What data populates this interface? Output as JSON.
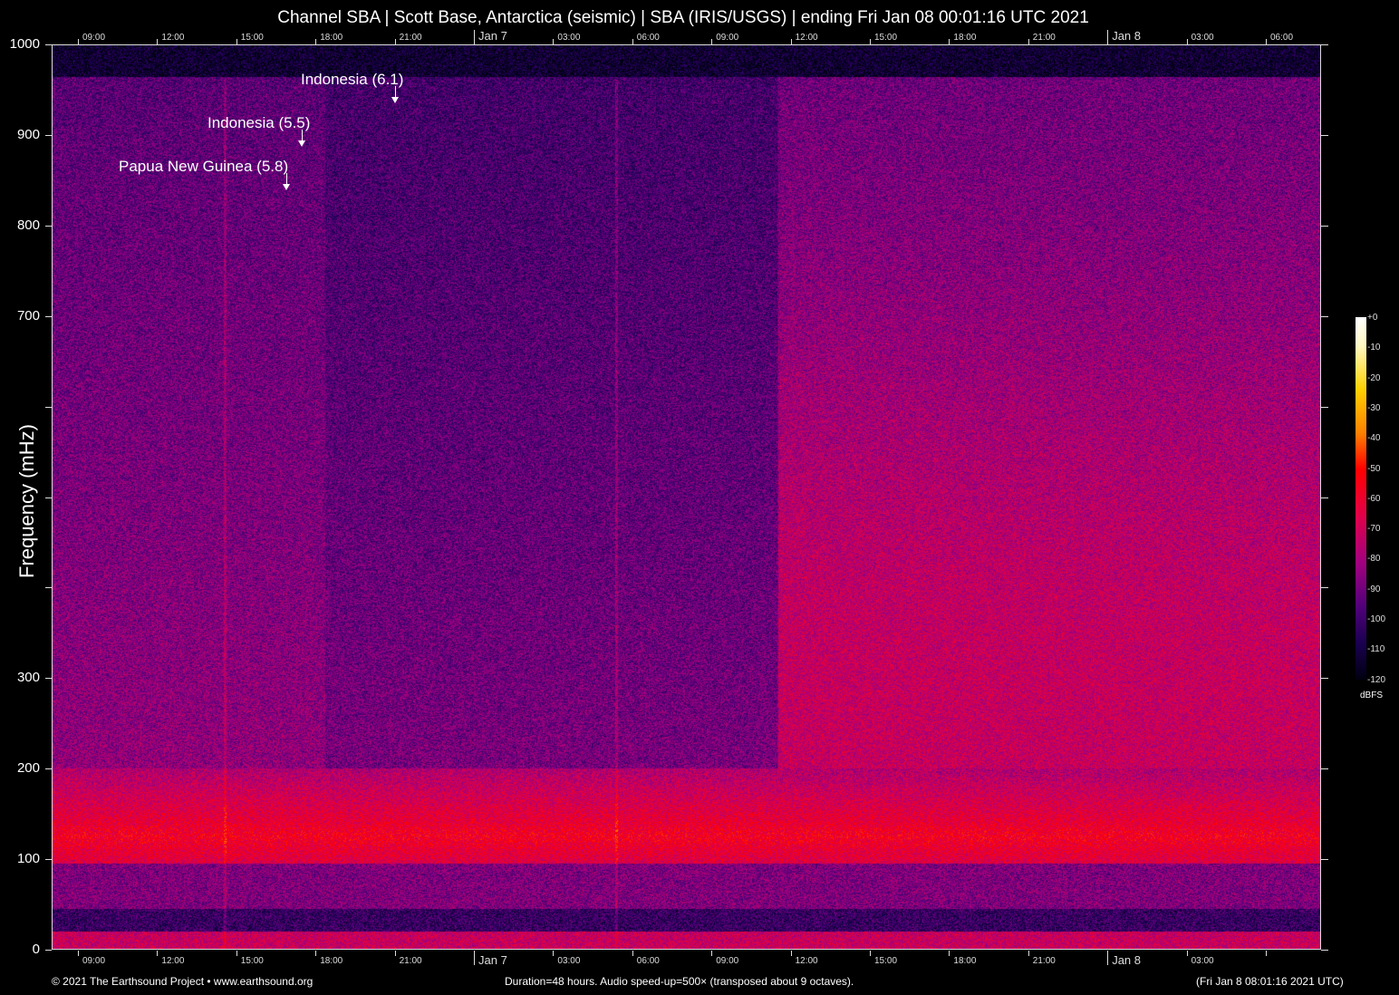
{
  "chart_data": {
    "type": "heatmap",
    "title": "Channel SBA | Scott Base, Antarctica (seismic) | SBA (IRIS/USGS) | ending Fri Jan 08 00:01:16 UTC 2021",
    "ylabel": "Frequency (mHz)",
    "ylim": [
      0,
      1000
    ],
    "y_ticks": [
      "0",
      "100",
      "200",
      "300",
      "",
      "",
      "",
      "700",
      "800",
      "900",
      "1000"
    ],
    "x_ticks_bottom": [
      "09:00",
      "12:00",
      "15:00",
      "18:00",
      "21:00",
      "Jan  7",
      "03:00",
      "06:00",
      "09:00",
      "12:00",
      "15:00",
      "18:00",
      "21:00",
      "Jan  8",
      "03:00",
      ""
    ],
    "x_ticks_top": [
      "09:00",
      "12:00",
      "15:00",
      "18:00",
      "21:00",
      "Jan  7",
      "03:00",
      "06:00",
      "09:00",
      "12:00",
      "15:00",
      "18:00",
      "21:00",
      "Jan  8",
      "03:00",
      "06:00"
    ],
    "colorbar": {
      "label": "dBFS",
      "ticks": [
        "+0",
        "-10",
        "-20",
        "-30",
        "-40",
        "-50",
        "-60",
        "-70",
        "-80",
        "-90",
        "-100",
        "-110",
        "-120"
      ],
      "range": [
        -120,
        0
      ]
    },
    "annotations": [
      {
        "text": "Indonesia (6.1)",
        "hours_from_start": 15.5
      },
      {
        "text": "Indonesia (5.5)",
        "hours_from_start": 10.0
      },
      {
        "text": "Papua New Guinea (5.8)",
        "hours_from_start": 8.9
      }
    ]
  },
  "footer": {
    "copyright": "© 2021 The Earthsound Project • www.earthsound.org",
    "duration": "Duration=48 hours. Audio speed-up=500× (transposed about 9 octaves).",
    "timestamp": "(Fri Jan  8 08:01:16 2021 UTC)"
  }
}
